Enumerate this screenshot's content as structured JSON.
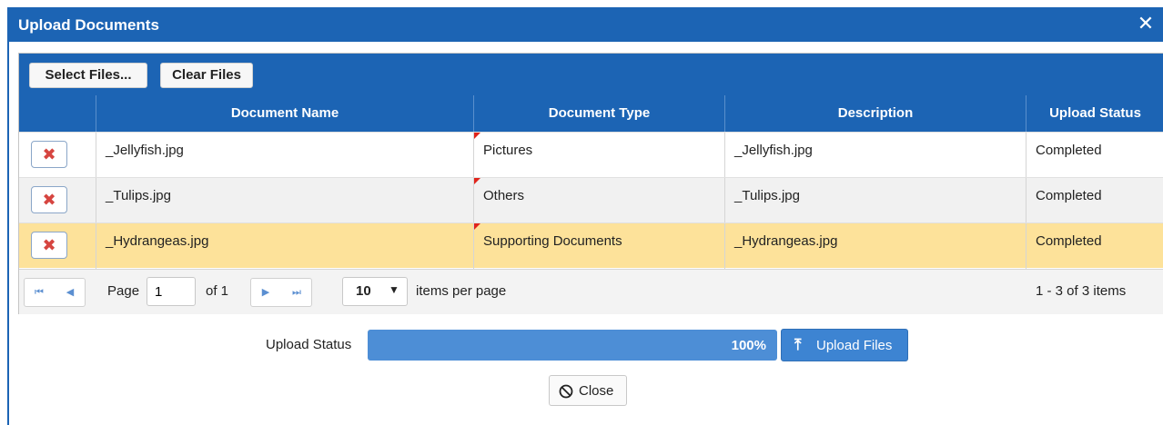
{
  "dialog": {
    "title": "Upload Documents",
    "close_glyph": "✕"
  },
  "toolbar": {
    "select_label": "Select Files...",
    "clear_label": "Clear Files"
  },
  "table": {
    "columns": [
      "",
      "Document Name",
      "Document Type",
      "Description",
      "Upload Status"
    ],
    "rows": [
      {
        "name": "_Jellyfish.jpg",
        "type": "Pictures",
        "description": "_Jellyfish.jpg",
        "status": "Completed",
        "bg": "#ffffff"
      },
      {
        "name": "_Tulips.jpg",
        "type": "Others",
        "description": "_Tulips.jpg",
        "status": "Completed",
        "bg": "#f1f1f1"
      },
      {
        "name": "_Hydrangeas.jpg",
        "type": "Supporting Documents",
        "description": "_Hydrangeas.jpg",
        "status": "Completed",
        "bg": "#fde29a"
      }
    ],
    "delete_glyph": "✖"
  },
  "pager": {
    "page_label": "Page",
    "page_value": "1",
    "of_label": "of 1",
    "page_size": "10",
    "items_per_page": "items per page",
    "summary": "1 - 3 of 3 items",
    "first_glyph": "⏮",
    "prev_glyph": "◀",
    "next_glyph": "▶",
    "last_glyph": "⏭",
    "dropdown_glyph": "▼"
  },
  "upload": {
    "status_label": "Upload Status",
    "progress_text": "100%",
    "progress_fraction": 1.0,
    "button_label": "Upload Files",
    "button_icon": "⤒"
  },
  "footer": {
    "close_label": "Close"
  },
  "colors": {
    "header_blue": "#1c64b4",
    "selected_row": "#fde29a",
    "progress_fill": "#4d8ed6",
    "delete_red": "#d64540"
  }
}
